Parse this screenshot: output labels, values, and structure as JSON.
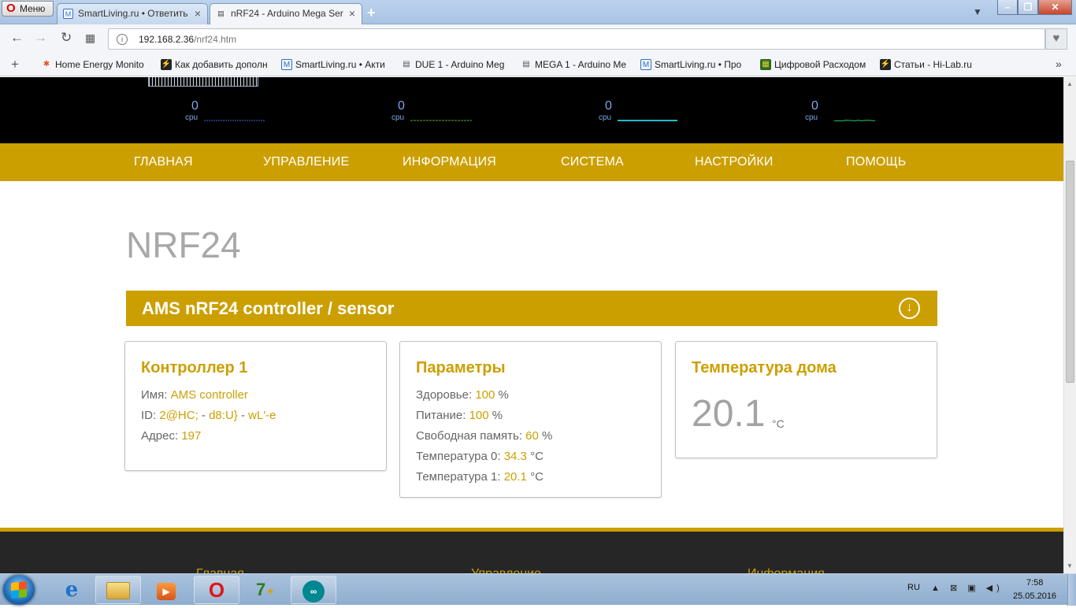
{
  "browser": {
    "menu_label": "Меню",
    "tabs": [
      {
        "title": "SmartLiving.ru • Ответить",
        "icon": "M"
      },
      {
        "title": "nRF24 - Arduino Mega Ser",
        "icon": "▤"
      }
    ],
    "address": {
      "host": "192.168.2.36",
      "path": "/nrf24.htm"
    },
    "bookmarks": [
      {
        "label": "Home Energy Monito",
        "icon": "joomla-icon"
      },
      {
        "label": "Как добавить дополн",
        "icon": "hilab-icon"
      },
      {
        "label": "SmartLiving.ru • Акти",
        "icon": "smartliving-icon"
      },
      {
        "label": "DUE 1 - Arduino Meg",
        "icon": "page-icon"
      },
      {
        "label": "MEGA 1 - Arduino Me",
        "icon": "page-icon"
      },
      {
        "label": "SmartLiving.ru • Про",
        "icon": "smartliving-icon"
      },
      {
        "label": "Цифровой Расходом",
        "icon": "circuit-icon"
      },
      {
        "label": "Статьи - Hi-Lab.ru",
        "icon": "hilab-icon"
      }
    ]
  },
  "header": {
    "cpu_monitors": [
      {
        "value": "0",
        "label": "cpu",
        "color": "#4466dd"
      },
      {
        "value": "0",
        "label": "cpu",
        "color": "#66aa33"
      },
      {
        "value": "0",
        "label": "cpu",
        "color": "#22b8c8"
      },
      {
        "value": "0",
        "label": "cpu",
        "color": "#22cc66"
      }
    ]
  },
  "nav": [
    "ГЛАВНАЯ",
    "УПРАВЛЕНИЕ",
    "ИНФОРМАЦИЯ",
    "СИСТЕМА",
    "НАСТРОЙКИ",
    "ПОМОЩЬ"
  ],
  "page": {
    "title": "NRF24",
    "panel_title": "AMS nRF24 controller / sensor"
  },
  "cards": {
    "controller": {
      "title": "Контроллер 1",
      "name_label": "Имя:",
      "name_value": "AMS controller",
      "id_label": "ID:",
      "id_part1": "2@HC;",
      "id_sep1": "-",
      "id_part2": "d8:U}",
      "id_sep2": "-",
      "id_part3": "wL'-e",
      "address_label": "Адрес:",
      "address_value": "197"
    },
    "params": {
      "title": "Параметры",
      "rows": [
        {
          "label": "Здоровье:",
          "value": "100",
          "unit": "%"
        },
        {
          "label": "Питание:",
          "value": "100",
          "unit": "%"
        },
        {
          "label": "Свободная память:",
          "value": "60",
          "unit": "%"
        },
        {
          "label": "Температура 0:",
          "value": "34.3",
          "unit": "°C"
        },
        {
          "label": "Температура 1:",
          "value": "20.1",
          "unit": "°C"
        }
      ]
    },
    "home_temp": {
      "title": "Температура дома",
      "value": "20.1",
      "unit": "°C"
    }
  },
  "footer": {
    "links": [
      "Главная",
      "Управление",
      "Информация"
    ]
  },
  "taskbar": {
    "apps": [
      "ie-icon",
      "explorer-icon",
      "media-player-icon",
      "opera-icon",
      "total-commander-icon",
      "arduino-icon"
    ],
    "lang": "RU",
    "time": "7:58",
    "date": "25.05.2016"
  },
  "colors": {
    "accent": "#cc9f00",
    "header_bg": "#000000",
    "footer_bg": "#262626"
  }
}
